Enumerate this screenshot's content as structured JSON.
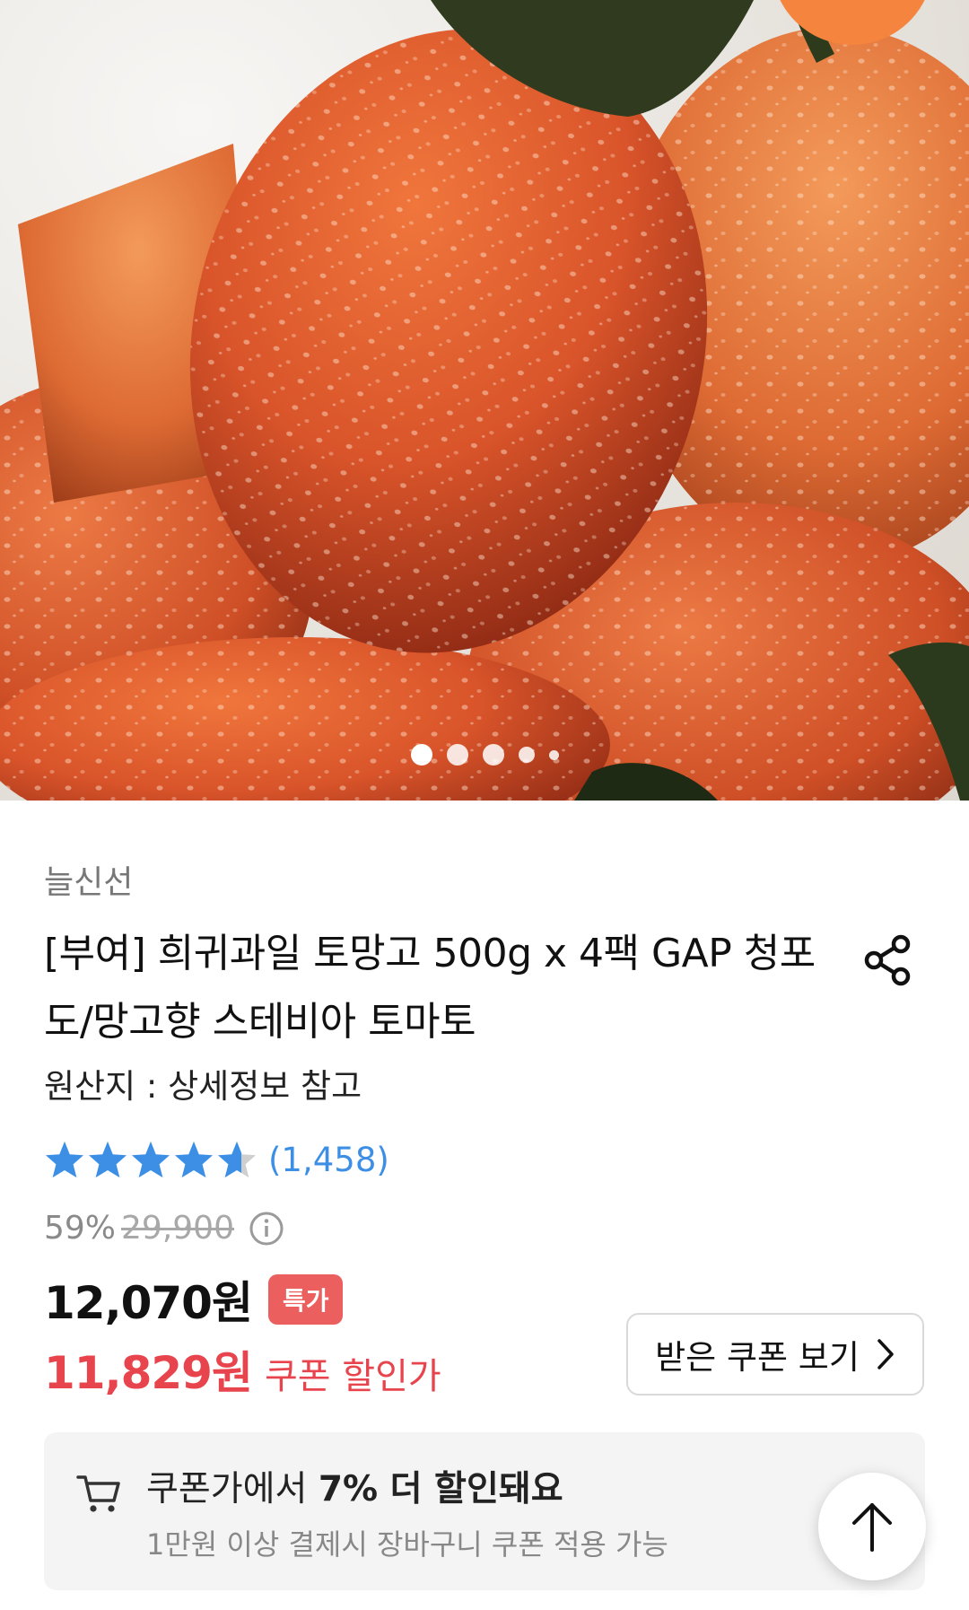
{
  "product": {
    "seller": "늘신선",
    "title": "[부여] 희귀과일 토망고 500g x 4팩 GAP 청포도/망고향 스테비아 토마토",
    "origin": "원산지 : 상세정보 참고",
    "rating": {
      "stars": 4.5,
      "count_text": "(1,458)"
    },
    "discount_percent": "59%",
    "original_price": "29,900",
    "price": "12,070원",
    "badge": "특가",
    "coupon_price": "11,829원",
    "coupon_label": "쿠폰 할인가",
    "coupon_button": "받은 쿠폰 보기"
  },
  "gallery": {
    "total_slides": 5,
    "active_index": 0
  },
  "cart_info": {
    "title_prefix": "쿠폰가에서 ",
    "title_bold": "7% 더 할인돼요",
    "subtitle": "1만원 이상 결제시 장바구니 쿠폰 적용 가능"
  },
  "icons": {
    "share": "share-icon",
    "info": "info-icon",
    "chevron": "chevron-right-icon",
    "cart": "cart-icon",
    "top": "arrow-up-icon",
    "star": "star-icon"
  },
  "colors": {
    "accent_red": "#e8444d",
    "badge_red": "#ec5f5f",
    "star_blue": "#3d8fe6",
    "rating_blue": "#3d8fe6"
  }
}
